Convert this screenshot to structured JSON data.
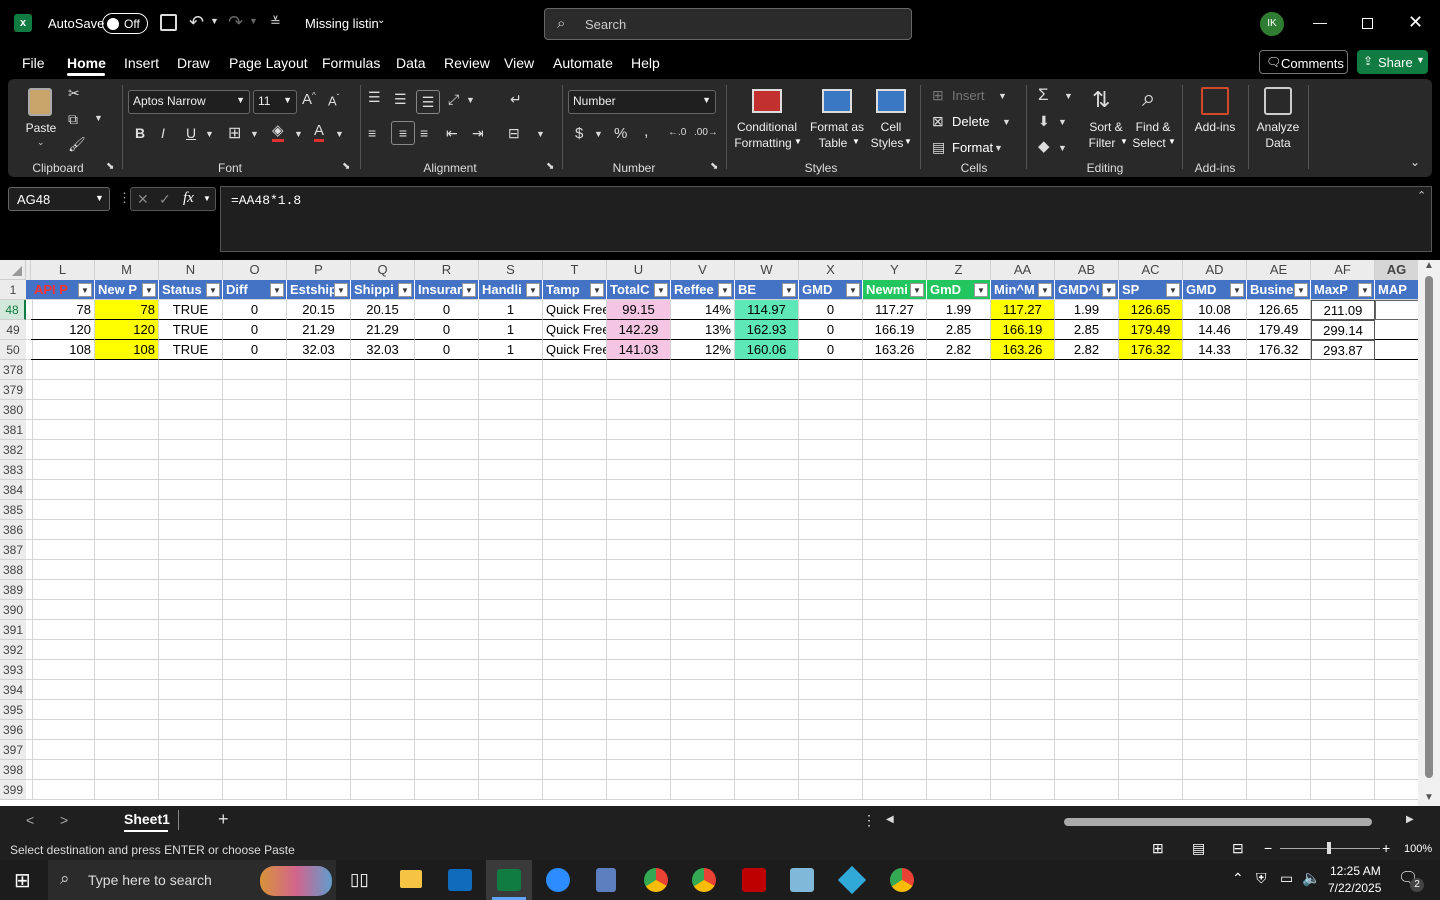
{
  "titlebar": {
    "autosave_label": "AutoSave",
    "autosave_state": "Off",
    "doc_title": "Missing listin",
    "search_placeholder": "Search",
    "avatar": "IK"
  },
  "menu": [
    "File",
    "Home",
    "Insert",
    "Draw",
    "Page Layout",
    "Formulas",
    "Data",
    "Review",
    "View",
    "Automate",
    "Help"
  ],
  "menu_active": "Home",
  "comments_label": "Comments",
  "share_label": "Share",
  "ribbon": {
    "paste": "Paste",
    "clipboard": "Clipboard",
    "font_name": "Aptos Narrow",
    "font_size": "11",
    "font": "Font",
    "alignment": "Alignment",
    "number_format": "Number",
    "number": "Number",
    "cond_fmt_1": "Conditional",
    "cond_fmt_2": "Formatting",
    "fmt_table_1": "Format as",
    "fmt_table_2": "Table",
    "cell_styles_1": "Cell",
    "cell_styles_2": "Styles",
    "styles": "Styles",
    "insert": "Insert",
    "delete": "Delete",
    "format": "Format",
    "cells": "Cells",
    "sort_1": "Sort &",
    "sort_2": "Filter",
    "find_1": "Find &",
    "find_2": "Select",
    "editing": "Editing",
    "addins": "Add-ins",
    "addins_group": "Add-ins",
    "analyze_1": "Analyze",
    "analyze_2": "Data"
  },
  "namebox": "AG48",
  "formula": "=AA48*1.8",
  "columns": [
    {
      "letter": "L",
      "header": "API P",
      "w": 64,
      "hbg": "#4472c4",
      "hfg": "#ff3030"
    },
    {
      "letter": "M",
      "header": "New P",
      "w": 64,
      "hbg": "#4472c4",
      "hfg": "#fff"
    },
    {
      "letter": "N",
      "header": "Status",
      "w": 64,
      "hbg": "#4472c4",
      "hfg": "#fff"
    },
    {
      "letter": "O",
      "header": "Diff",
      "w": 64,
      "hbg": "#4472c4",
      "hfg": "#fff"
    },
    {
      "letter": "P",
      "header": "Estship",
      "w": 64,
      "hbg": "#4472c4",
      "hfg": "#fff"
    },
    {
      "letter": "Q",
      "header": "Shippi",
      "w": 64,
      "hbg": "#4472c4",
      "hfg": "#fff"
    },
    {
      "letter": "R",
      "header": "Insurar",
      "w": 64,
      "hbg": "#4472c4",
      "hfg": "#fff"
    },
    {
      "letter": "S",
      "header": "Handli",
      "w": 64,
      "hbg": "#4472c4",
      "hfg": "#fff"
    },
    {
      "letter": "T",
      "header": "Tamp",
      "w": 64,
      "hbg": "#4472c4",
      "hfg": "#fff"
    },
    {
      "letter": "U",
      "header": "TotalC",
      "w": 64,
      "hbg": "#4472c4",
      "hfg": "#fff"
    },
    {
      "letter": "V",
      "header": "Reffee",
      "w": 64,
      "hbg": "#4472c4",
      "hfg": "#fff"
    },
    {
      "letter": "W",
      "header": "BE",
      "w": 64,
      "hbg": "#4472c4",
      "hfg": "#fff"
    },
    {
      "letter": "X",
      "header": "GMD",
      "w": 64,
      "hbg": "#4472c4",
      "hfg": "#fff"
    },
    {
      "letter": "Y",
      "header": "Newmi",
      "w": 64,
      "hbg": "#22c55e",
      "hfg": "#fff"
    },
    {
      "letter": "Z",
      "header": "GmD",
      "w": 64,
      "hbg": "#22c55e",
      "hfg": "#fff"
    },
    {
      "letter": "AA",
      "header": "Min^M",
      "w": 64,
      "hbg": "#4472c4",
      "hfg": "#fff"
    },
    {
      "letter": "AB",
      "header": "GMD^I",
      "w": 64,
      "hbg": "#4472c4",
      "hfg": "#fff"
    },
    {
      "letter": "AC",
      "header": "SP",
      "w": 64,
      "hbg": "#4472c4",
      "hfg": "#fff"
    },
    {
      "letter": "AD",
      "header": "GMD",
      "w": 64,
      "hbg": "#4472c4",
      "hfg": "#fff"
    },
    {
      "letter": "AE",
      "header": "Busine",
      "w": 64,
      "hbg": "#4472c4",
      "hfg": "#fff"
    },
    {
      "letter": "AF",
      "header": "MaxP",
      "w": 64,
      "hbg": "#4472c4",
      "hfg": "#fff"
    },
    {
      "letter": "AG",
      "header": "MAP",
      "w": 44,
      "hbg": "#4472c4",
      "hfg": "#fff"
    }
  ],
  "rows": [
    {
      "num": "48",
      "cells": [
        "78",
        "78",
        "TRUE",
        "0",
        "20.15",
        "20.15",
        "0",
        "1",
        "Quick Free",
        "99.15",
        "14%",
        "114.97",
        "0",
        "117.27",
        "1.99",
        "117.27",
        "1.99",
        "126.65",
        "10.08",
        "126.65",
        "211.09",
        ""
      ]
    },
    {
      "num": "49",
      "cells": [
        "120",
        "120",
        "TRUE",
        "0",
        "21.29",
        "21.29",
        "0",
        "1",
        "Quick Free",
        "142.29",
        "13%",
        "162.93",
        "0",
        "166.19",
        "2.85",
        "166.19",
        "2.85",
        "179.49",
        "14.46",
        "179.49",
        "299.14",
        ""
      ]
    },
    {
      "num": "50",
      "cells": [
        "108",
        "108",
        "TRUE",
        "0",
        "32.03",
        "32.03",
        "0",
        "1",
        "Quick Free",
        "141.03",
        "12%",
        "160.06",
        "0",
        "163.26",
        "2.82",
        "163.26",
        "2.82",
        "176.32",
        "14.33",
        "176.32",
        "293.87",
        ""
      ]
    }
  ],
  "empty_rows": [
    "378",
    "379",
    "380",
    "381",
    "382",
    "383",
    "384",
    "385",
    "386",
    "387",
    "388",
    "389",
    "390",
    "391",
    "392",
    "393",
    "394",
    "395",
    "396",
    "397",
    "398",
    "399"
  ],
  "sheet_tab": "Sheet1",
  "status_text": "Select destination and press ENTER or choose Paste",
  "zoom": "100%",
  "taskbar": {
    "search_placeholder": "Type here to search",
    "time": "12:25 AM",
    "date": "7/22/2025",
    "notif_count": "2"
  },
  "colors": {
    "yellow": "#ffff00",
    "pink": "#f4c6e4",
    "teal": "#5ee8b8",
    "accent": "#107c41"
  }
}
